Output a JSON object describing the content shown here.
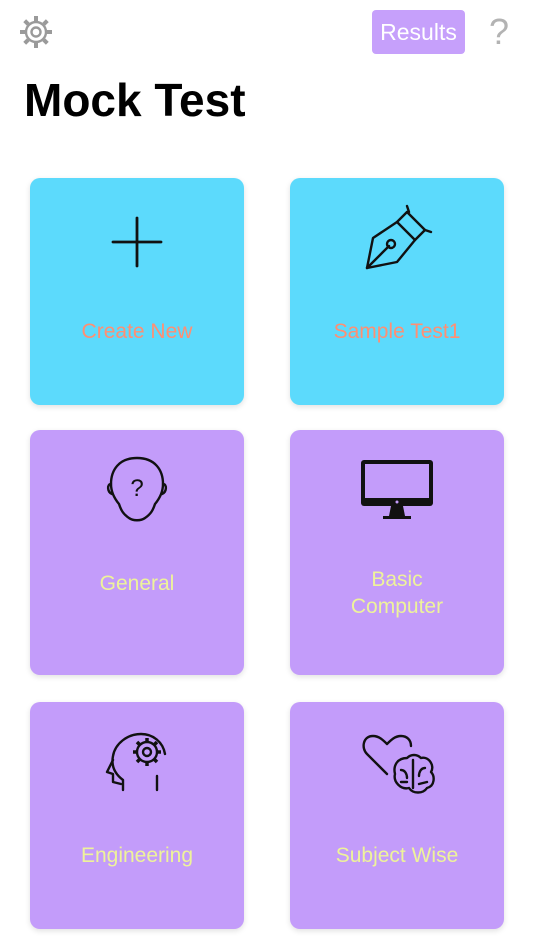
{
  "header": {
    "settings_icon": "gear-icon",
    "results_label": "Results",
    "help_label": "?",
    "title": "Mock Test"
  },
  "colors": {
    "blue_tile": "#5cdafc",
    "purple_tile": "#c39cfa",
    "blue_label": "#ff8f73",
    "purple_label": "#eef39a",
    "results_button": "#c6a0fb"
  },
  "tiles": [
    {
      "label": "Create New",
      "icon": "plus-icon"
    },
    {
      "label": "Sample Test1",
      "icon": "pen-nib-icon"
    },
    {
      "label": "General",
      "icon": "head-question-icon"
    },
    {
      "label_line1": "Basic",
      "label_line2": "Computer",
      "icon": "monitor-icon"
    },
    {
      "label": "Engineering",
      "icon": "head-gear-icon"
    },
    {
      "label": "Subject Wise",
      "icon": "heart-brain-icon"
    }
  ]
}
